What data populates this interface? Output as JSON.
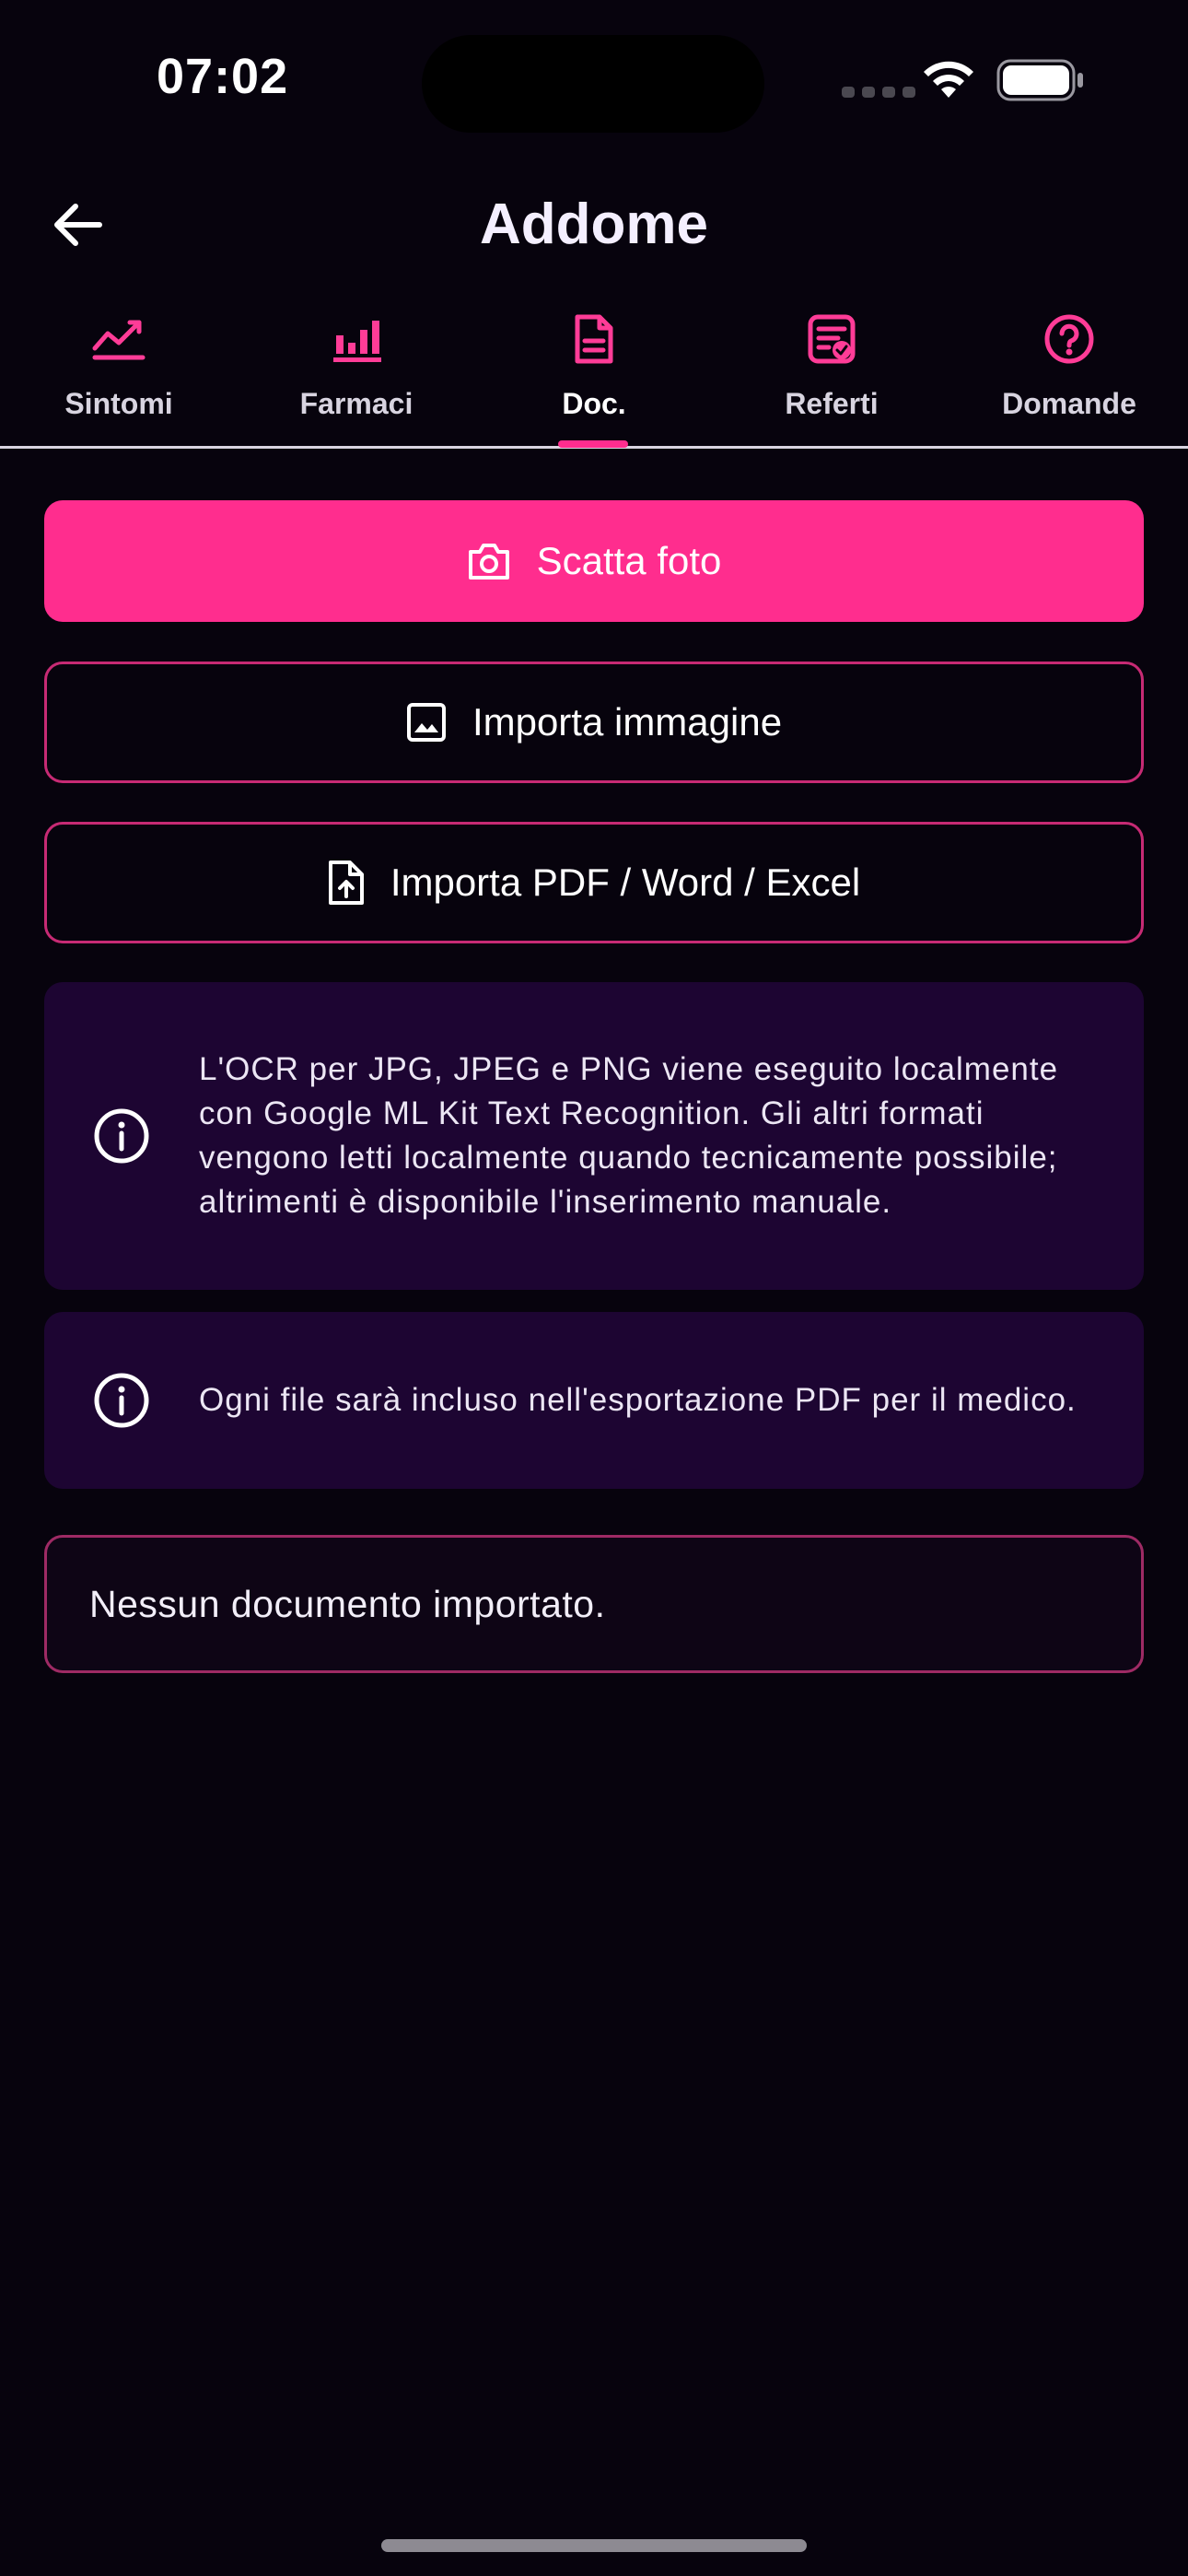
{
  "status_bar": {
    "time": "07:02"
  },
  "app_bar": {
    "title": "Addome"
  },
  "tabs": [
    {
      "label": "Sintomi",
      "icon": "trend-chart-icon",
      "active": false
    },
    {
      "label": "Farmaci",
      "icon": "bar-chart-icon",
      "active": false
    },
    {
      "label": "Doc.",
      "icon": "document-icon",
      "active": true
    },
    {
      "label": "Referti",
      "icon": "report-check-icon",
      "active": false
    },
    {
      "label": "Domande",
      "icon": "question-circle-icon",
      "active": false
    }
  ],
  "actions": {
    "take_photo": "Scatta foto",
    "import_image": "Importa immagine",
    "import_docs": "Importa PDF / Word / Excel"
  },
  "info": {
    "ocr_note": "L'OCR per JPG, JPEG e PNG viene eseguito localmente con Google ML Kit Text Recognition. Gli altri formati vengono letti localmente quando tecnicamente possibile; altrimenti è disponibile l'inserimento manuale.",
    "export_note": "Ogni file sarà incluso nell'esportazione PDF per il medico."
  },
  "documents": {
    "empty_text": "Nessun documento importato."
  },
  "colors": {
    "accent": "#ff2d8e",
    "background": "#07030d",
    "info_card": "#1d0532",
    "outline": "#c72a74"
  }
}
